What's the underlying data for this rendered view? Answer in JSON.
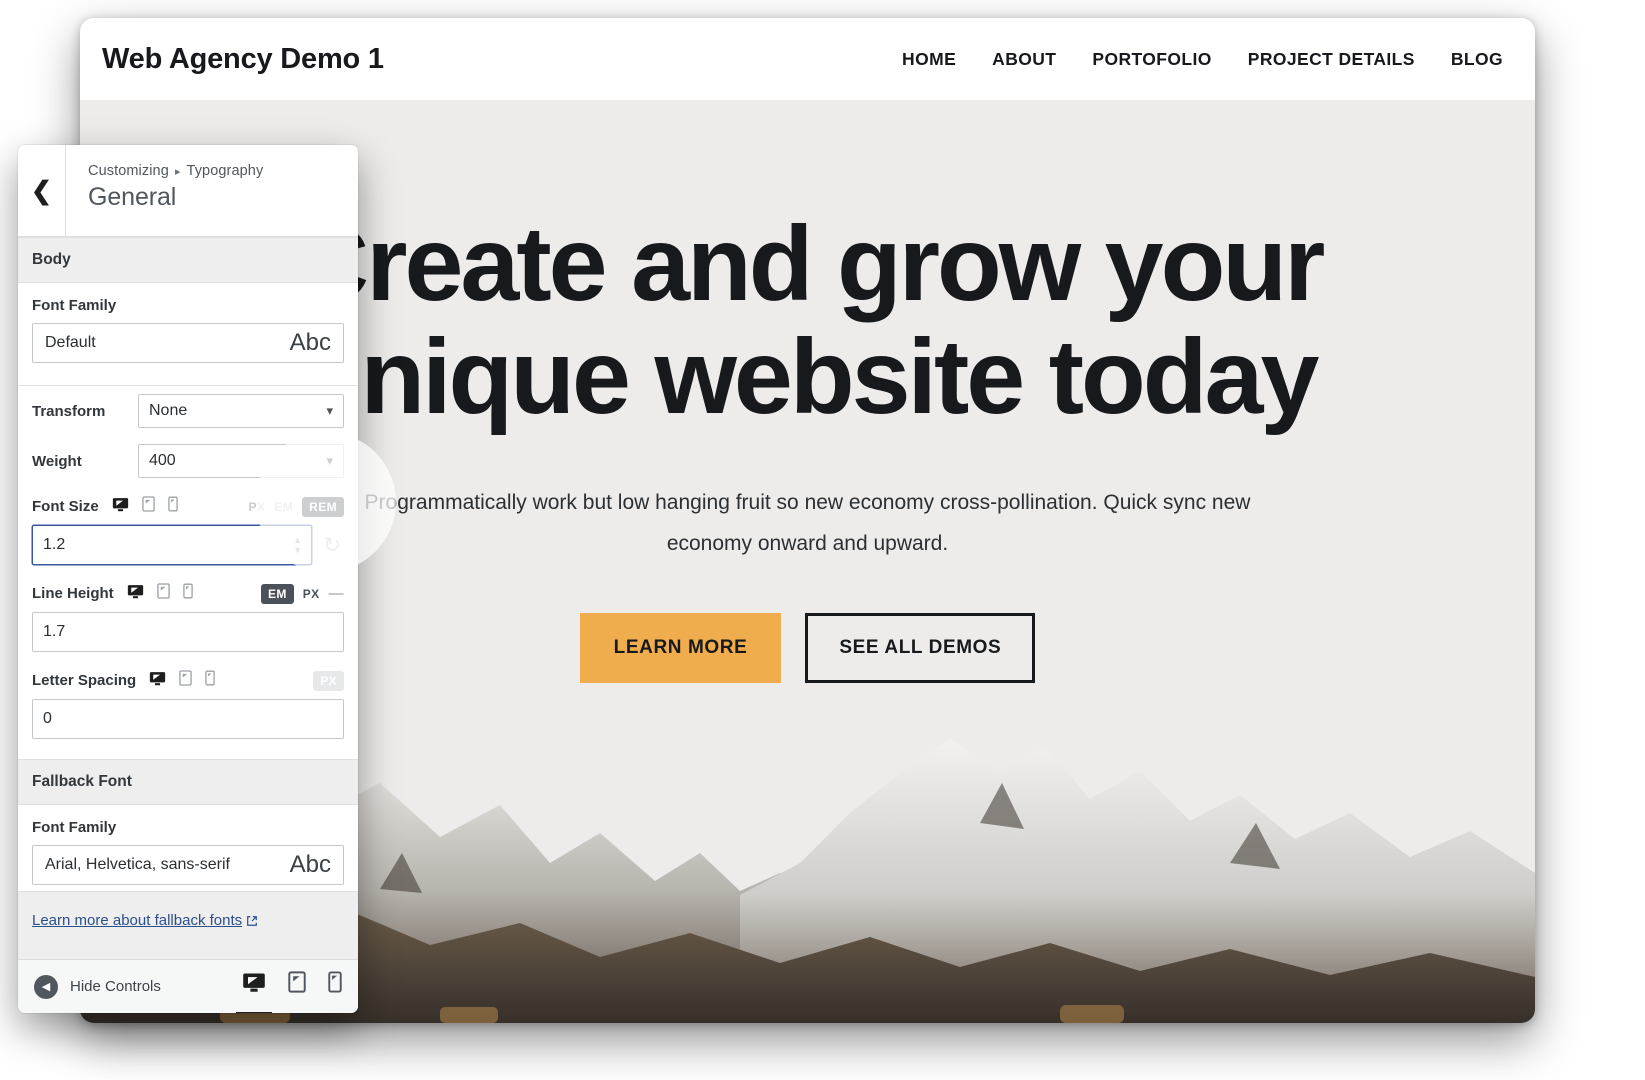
{
  "site": {
    "logo": "Web Agency Demo 1",
    "nav": [
      {
        "label": "HOME"
      },
      {
        "label": "ABOUT"
      },
      {
        "label": "PORTOFOLIO"
      },
      {
        "label": "PROJECT DETAILS"
      },
      {
        "label": "BLOG"
      }
    ],
    "hero": {
      "title": "Create and grow your unique website today",
      "subtitle": "Programmatically work but low hanging fruit so new economy cross-pollination. Quick sync new economy onward and upward.",
      "primary_button": "LEARN MORE",
      "secondary_button": "SEE ALL DEMOS"
    },
    "colors": {
      "accent_orange": "#efad4e",
      "hero_background": "#edecea",
      "text_dark": "#17191c"
    }
  },
  "customizer": {
    "back_icon": "chevron-left-icon",
    "breadcrumb_root": "Customizing",
    "breadcrumb_separator": "▸",
    "breadcrumb_current": "Typography",
    "panel_title": "General",
    "sections": [
      {
        "heading": "Body",
        "font_family": {
          "label": "Font Family",
          "value": "Default",
          "preview": "Abc"
        },
        "transform": {
          "label": "Transform",
          "value": "None"
        },
        "weight": {
          "label": "Weight",
          "value": "400"
        },
        "font_size": {
          "label": "Font Size",
          "value": "1.2",
          "units": [
            {
              "label": "PX",
              "state": "inactive"
            },
            {
              "label": "EM",
              "state": "inactive"
            },
            {
              "label": "REM",
              "state": "active"
            }
          ]
        },
        "line_height": {
          "label": "Line Height",
          "value": "1.7",
          "units": [
            {
              "label": "EM",
              "state": "active"
            },
            {
              "label": "PX",
              "state": "inactive"
            },
            {
              "label": "—",
              "state": "dash"
            }
          ]
        },
        "letter_spacing": {
          "label": "Letter Spacing",
          "value": "0",
          "units": [
            {
              "label": "PX",
              "state": "boxdim"
            }
          ]
        }
      },
      {
        "heading": "Fallback Font",
        "font_family": {
          "label": "Font Family",
          "value": "Arial, Helvetica, sans-serif",
          "preview": "Abc"
        }
      }
    ],
    "help_link": {
      "text": "Learn more about fallback fonts",
      "icon": "external-link-icon"
    },
    "footer": {
      "hide_controls": "Hide Controls",
      "devices": [
        {
          "name": "desktop",
          "active": true
        },
        {
          "name": "tablet",
          "active": false
        },
        {
          "name": "mobile",
          "active": false
        }
      ]
    },
    "device_icons": [
      {
        "name": "desktop",
        "active": true
      },
      {
        "name": "tablet",
        "active": false
      },
      {
        "name": "mobile",
        "active": false
      }
    ]
  }
}
